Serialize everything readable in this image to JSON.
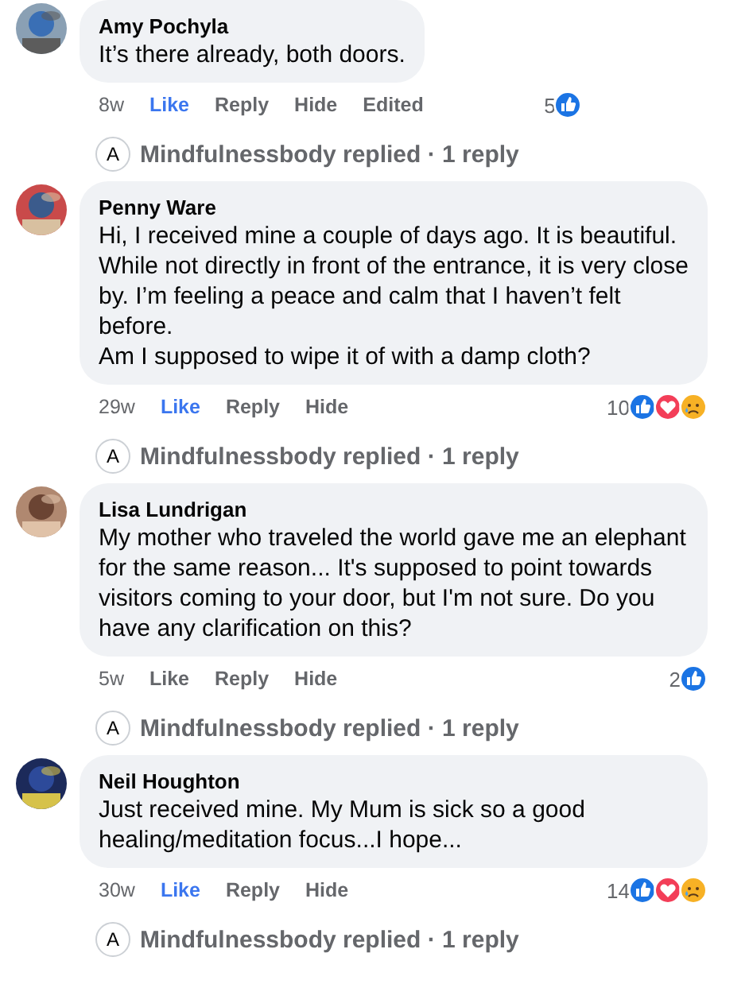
{
  "comments": [
    {
      "author": "Amy Pochyla",
      "avatar": {
        "kind": "picture"
      },
      "wide": false,
      "lines": [
        "It’s there already, both doors."
      ],
      "time": "8w",
      "actions": [
        {
          "label": "Like",
          "selected": true
        },
        {
          "label": "Reply",
          "selected": false
        },
        {
          "label": "Hide",
          "selected": false
        },
        {
          "label": "Edited",
          "selected": false
        }
      ],
      "reaction_count": "5",
      "reactions": [
        {
          "kind": "like"
        }
      ],
      "reply": {
        "avatar_letter": "A",
        "text": "Mindfulnessbody replied · 1 reply"
      }
    },
    {
      "author": "Penny Ware",
      "avatar": {
        "kind": "picture"
      },
      "wide": true,
      "lines": [
        "Hi, I received mine a couple of days ago. It is beautiful. While not directly in front of the entrance, it is very close by. I’m feeling a peace and calm that I haven’t felt before.",
        "Am I supposed to wipe it of with a damp cloth?"
      ],
      "time": "29w",
      "actions": [
        {
          "label": "Like",
          "selected": true
        },
        {
          "label": "Reply",
          "selected": false
        },
        {
          "label": "Hide",
          "selected": false
        }
      ],
      "reaction_count": "10",
      "reactions": [
        {
          "kind": "like"
        },
        {
          "kind": "love"
        },
        {
          "kind": "sad"
        }
      ],
      "reply": {
        "avatar_letter": "A",
        "text": "Mindfulnessbody replied · 1 reply"
      }
    },
    {
      "author": "Lisa Lundrigan",
      "avatar": {
        "kind": "picture"
      },
      "wide": true,
      "lines": [
        "My mother who traveled the world gave me an elephant for the same reason... It's supposed to point towards visitors coming to your door, but I'm not sure. Do you have any clarification on this?"
      ],
      "time": "5w",
      "actions": [
        {
          "label": "Like",
          "selected": false
        },
        {
          "label": "Reply",
          "selected": false
        },
        {
          "label": "Hide",
          "selected": false
        }
      ],
      "reaction_count": "2",
      "reactions": [
        {
          "kind": "like"
        }
      ],
      "reply": {
        "avatar_letter": "A",
        "text": "Mindfulnessbody replied · 1 reply"
      }
    },
    {
      "author": "Neil Houghton",
      "avatar": {
        "kind": "picture"
      },
      "wide": true,
      "lines": [
        "Just received mine. My Mum is sick so a good healing/meditation focus...I hope..."
      ],
      "time": "30w",
      "actions": [
        {
          "label": "Like",
          "selected": true
        },
        {
          "label": "Reply",
          "selected": false
        },
        {
          "label": "Hide",
          "selected": false
        }
      ],
      "reaction_count": "14",
      "reactions": [
        {
          "kind": "like"
        },
        {
          "kind": "love"
        },
        {
          "kind": "sad"
        }
      ],
      "reply": {
        "avatar_letter": "A",
        "text": "Mindfulnessbody replied · 1 reply"
      }
    }
  ]
}
